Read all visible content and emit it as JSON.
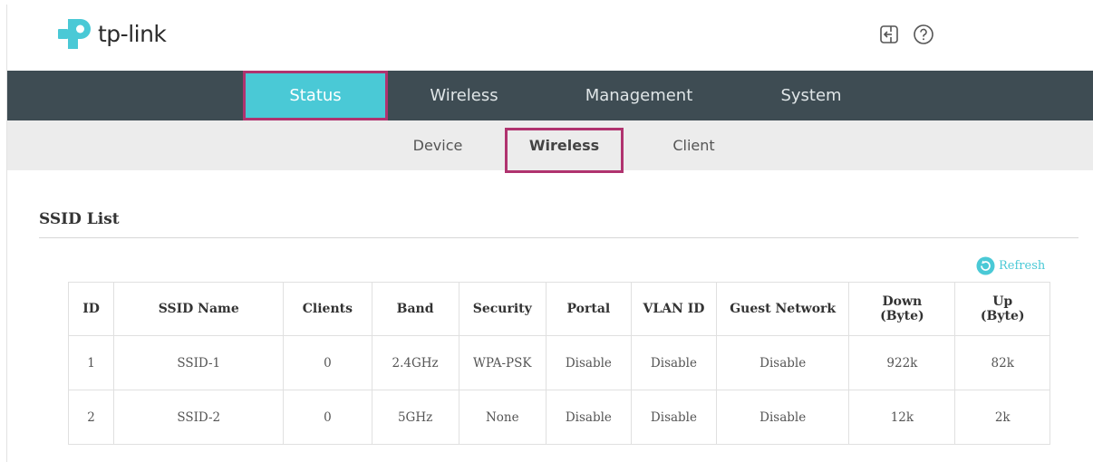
{
  "brand": {
    "name": "tp-link",
    "color": "#4ac9d6"
  },
  "header": {
    "icons": [
      {
        "name": "logout-icon"
      },
      {
        "name": "help-icon"
      }
    ]
  },
  "main_nav": {
    "tabs": [
      {
        "label": "Status",
        "active": true
      },
      {
        "label": "Wireless",
        "active": false
      },
      {
        "label": "Management",
        "active": false
      },
      {
        "label": "System",
        "active": false
      }
    ]
  },
  "sub_nav": {
    "tabs": [
      {
        "label": "Device",
        "active": false
      },
      {
        "label": "Wireless",
        "active": true
      },
      {
        "label": "Client",
        "active": false
      }
    ]
  },
  "highlight_color": "#b0336f",
  "section": {
    "title": "SSID List",
    "refresh_label": "Refresh"
  },
  "table": {
    "headers": {
      "id": "ID",
      "ssid_name": "SSID Name",
      "clients": "Clients",
      "band": "Band",
      "security": "Security",
      "portal": "Portal",
      "vlan_id": "VLAN ID",
      "guest_network": "Guest Network",
      "down_1": "Down",
      "down_2": "(Byte)",
      "up_1": "Up",
      "up_2": "(Byte)"
    },
    "rows": [
      {
        "id": "1",
        "ssid_name": "SSID-1",
        "clients": "0",
        "band": "2.4GHz",
        "security": "WPA-PSK",
        "portal": "Disable",
        "vlan_id": "Disable",
        "guest_network": "Disable",
        "down": "922k",
        "up": "82k"
      },
      {
        "id": "2",
        "ssid_name": "SSID-2",
        "clients": "0",
        "band": "5GHz",
        "security": "None",
        "portal": "Disable",
        "vlan_id": "Disable",
        "guest_network": "Disable",
        "down": "12k",
        "up": "2k"
      }
    ]
  }
}
